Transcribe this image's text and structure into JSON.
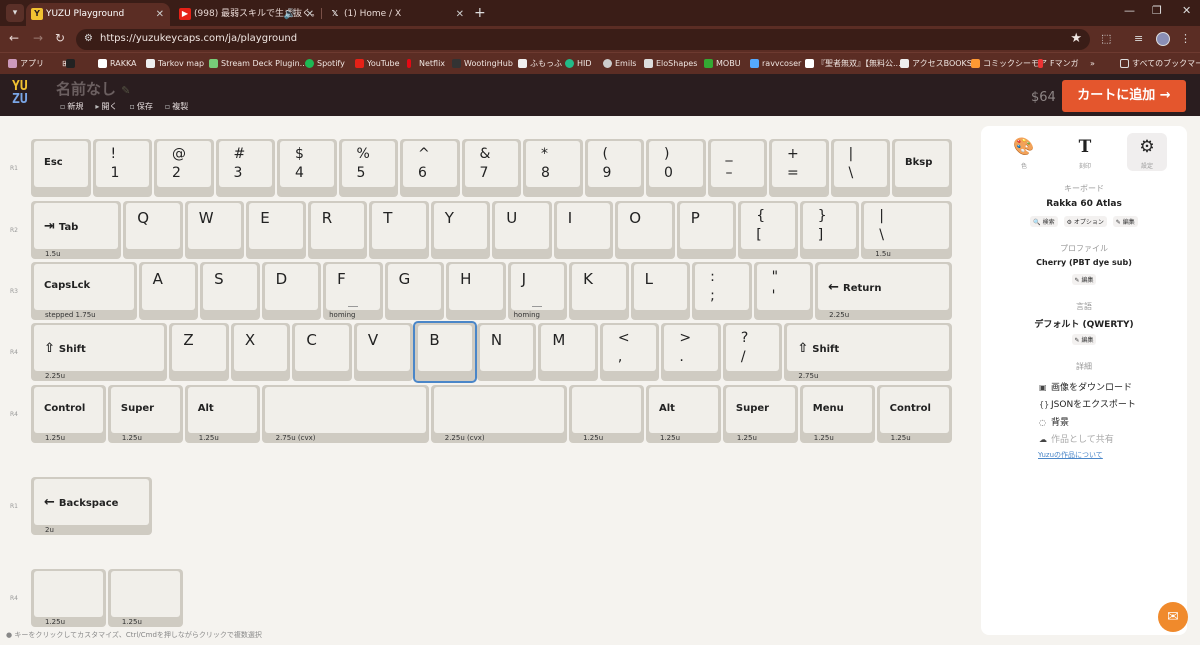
{
  "browser": {
    "tabs": [
      {
        "title": "YUZU Playground",
        "active": true,
        "icon": "yuzu-favicon"
      },
      {
        "title": "(998) 最弱スキルで生き抜く。",
        "active": false,
        "icon": "youtube-favicon"
      },
      {
        "title": "(1) Home / X",
        "active": false,
        "icon": "x-favicon"
      }
    ],
    "url": "https://yuzukeycaps.com/ja/playground",
    "bookmarks": [
      "アプリ",
      "RAKKA",
      "Tarkov map",
      "Stream Deck Plugin...",
      "Spotify",
      "YouTube",
      "Netflix",
      "WootingHub",
      "ふもっふ",
      "HID",
      "Emils",
      "EloShapes",
      "MOBU",
      "ravvcoser",
      "『聖者無双』【無料公...",
      "アクセスBOOKS",
      "コミックシーモア",
      "Fマンガ",
      "すべてのブックマーク"
    ],
    "overflow": "»"
  },
  "app": {
    "logo_top": "YU",
    "logo_bottom": "ZU",
    "doc_title": "名前なし",
    "doc_sub": "✎",
    "menu": [
      {
        "icon": "▫",
        "label": "新規"
      },
      {
        "icon": "▸",
        "label": "開く"
      },
      {
        "icon": "▫",
        "label": "保存"
      },
      {
        "icon": "▫",
        "label": "複製"
      }
    ],
    "price": "$64",
    "cart_label": "カートに追加 →"
  },
  "keyboard": {
    "row_labels": [
      "R1",
      "R2",
      "R3",
      "R4",
      "R4",
      "R1",
      "R4"
    ],
    "keys": [
      {
        "id": "esc",
        "leg": "Esc",
        "type": "mod"
      },
      {
        "id": "1",
        "leg": "!\n1",
        "type": "dual"
      },
      {
        "id": "2",
        "leg": "@\n2",
        "type": "dual"
      },
      {
        "id": "3",
        "leg": "#\n3",
        "type": "dual"
      },
      {
        "id": "4",
        "leg": "$\n4",
        "type": "dual"
      },
      {
        "id": "5",
        "leg": "%\n5",
        "type": "dual"
      },
      {
        "id": "6",
        "leg": "^\n6",
        "type": "dual"
      },
      {
        "id": "7",
        "leg": "&\n7",
        "type": "dual"
      },
      {
        "id": "8",
        "leg": "*\n8",
        "type": "dual"
      },
      {
        "id": "9",
        "leg": "(\n9",
        "type": "dual"
      },
      {
        "id": "0",
        "leg": ")\n0",
        "type": "dual"
      },
      {
        "id": "minus",
        "leg": "_\n–",
        "type": "dual"
      },
      {
        "id": "equal",
        "leg": "+\n=",
        "type": "dual"
      },
      {
        "id": "backslash-r1",
        "leg": "|\n\\",
        "type": "dual"
      },
      {
        "id": "bksp",
        "leg": "Bksp",
        "type": "mod"
      },
      {
        "id": "tab",
        "leg": "Tab",
        "type": "mod",
        "icon": "⇥",
        "size": "1.5u"
      },
      {
        "id": "q",
        "leg": "Q",
        "type": "big"
      },
      {
        "id": "w",
        "leg": "W",
        "type": "big"
      },
      {
        "id": "e",
        "leg": "E",
        "type": "big"
      },
      {
        "id": "r",
        "leg": "R",
        "type": "big"
      },
      {
        "id": "t",
        "leg": "T",
        "type": "big"
      },
      {
        "id": "y",
        "leg": "Y",
        "type": "big"
      },
      {
        "id": "u",
        "leg": "U",
        "type": "big"
      },
      {
        "id": "i",
        "leg": "I",
        "type": "big"
      },
      {
        "id": "o",
        "leg": "O",
        "type": "big"
      },
      {
        "id": "p",
        "leg": "P",
        "type": "big"
      },
      {
        "id": "lbracket",
        "leg": "{\n[",
        "type": "dual"
      },
      {
        "id": "rbracket",
        "leg": "}\n]",
        "type": "dual"
      },
      {
        "id": "pipe",
        "leg": "|\n\\",
        "type": "dual",
        "size": "1.5u"
      },
      {
        "id": "caps",
        "leg": "CapsLck",
        "type": "mod",
        "size": "stepped 1.75u"
      },
      {
        "id": "a",
        "leg": "A",
        "type": "big"
      },
      {
        "id": "s",
        "leg": "S",
        "type": "big"
      },
      {
        "id": "d",
        "leg": "D",
        "type": "big"
      },
      {
        "id": "f",
        "leg": "F",
        "type": "big",
        "homing": "homing"
      },
      {
        "id": "g",
        "leg": "G",
        "type": "big"
      },
      {
        "id": "h",
        "leg": "H",
        "type": "big"
      },
      {
        "id": "j",
        "leg": "J",
        "type": "big",
        "homing": "homing"
      },
      {
        "id": "k",
        "leg": "K",
        "type": "big"
      },
      {
        "id": "l",
        "leg": "L",
        "type": "big"
      },
      {
        "id": "semicolon",
        "leg": ":\n;",
        "type": "dual"
      },
      {
        "id": "quote",
        "leg": "\"\n'",
        "type": "dual"
      },
      {
        "id": "return",
        "leg": "Return",
        "type": "mod",
        "icon": "←",
        "size": "2.25u"
      },
      {
        "id": "lshift",
        "leg": "Shift",
        "type": "mod",
        "icon": "⇧",
        "size": "2.25u"
      },
      {
        "id": "z",
        "leg": "Z",
        "type": "big"
      },
      {
        "id": "x",
        "leg": "X",
        "type": "big"
      },
      {
        "id": "c",
        "leg": "C",
        "type": "big"
      },
      {
        "id": "v",
        "leg": "V",
        "type": "big"
      },
      {
        "id": "b",
        "leg": "B",
        "type": "big",
        "selected": true
      },
      {
        "id": "n",
        "leg": "N",
        "type": "big"
      },
      {
        "id": "m",
        "leg": "M",
        "type": "big"
      },
      {
        "id": "comma",
        "leg": "<\n,",
        "type": "dual"
      },
      {
        "id": "period",
        "leg": ">\n.",
        "type": "dual"
      },
      {
        "id": "slash",
        "leg": "?\n/",
        "type": "dual"
      },
      {
        "id": "rshift",
        "leg": "Shift",
        "type": "mod",
        "icon": "⇧",
        "size": "2.75u"
      },
      {
        "id": "lctrl",
        "leg": "Control",
        "type": "mod",
        "size": "1.25u"
      },
      {
        "id": "lsuper",
        "leg": "Super",
        "type": "mod",
        "size": "1.25u"
      },
      {
        "id": "lalt",
        "leg": "Alt",
        "type": "mod",
        "size": "1.25u"
      },
      {
        "id": "space1",
        "leg": "",
        "type": "mod",
        "size": "2.75u (cvx)"
      },
      {
        "id": "space2",
        "leg": "",
        "type": "mod",
        "size": "2.25u (cvx)"
      },
      {
        "id": "space3",
        "leg": "",
        "type": "mod",
        "size": "1.25u"
      },
      {
        "id": "ralt",
        "leg": "Alt",
        "type": "mod",
        "size": "1.25u"
      },
      {
        "id": "rsuper",
        "leg": "Super",
        "type": "mod",
        "size": "1.25u"
      },
      {
        "id": "menu",
        "leg": "Menu",
        "type": "mod",
        "size": "1.25u"
      },
      {
        "id": "rctrl",
        "leg": "Control",
        "type": "mod",
        "size": "1.25u"
      },
      {
        "id": "backspace-alt",
        "leg": "Backspace",
        "type": "mod",
        "icon": "←",
        "size": "2u"
      },
      {
        "id": "extra1",
        "leg": "",
        "type": "mod",
        "size": "1.25u"
      },
      {
        "id": "extra2",
        "leg": "",
        "type": "mod",
        "size": "1.25u"
      }
    ]
  },
  "hint": "キーをクリックしてカスタマイズ、Ctrl/Cmdを押しながらクリックで複数選択",
  "panel": {
    "tabs": [
      {
        "icon": "palette-icon",
        "glyph": "🎨",
        "label": "色"
      },
      {
        "icon": "text-icon",
        "glyph": "T",
        "label": "刻印"
      },
      {
        "icon": "gear-icon",
        "glyph": "⚙",
        "label": "設定"
      }
    ],
    "keyboard_h": "キーボード",
    "keyboard_v": "Rakka 60 Atlas",
    "keyboard_links": [
      "🔍 検索",
      "⚙ オプション",
      "✎ 編集"
    ],
    "profile_h": "プロファイル",
    "profile_v": "Cherry (PBT dye sub)",
    "profile_link": "✎ 編集",
    "lang_h": "言語",
    "lang_v": "デフォルト (QWERTY)",
    "lang_link": "✎ 編集",
    "detail_h": "詳細",
    "details": [
      {
        "icon": "image-icon",
        "glyph": "▣",
        "label": "画像をダウンロード",
        "disabled": false
      },
      {
        "icon": "json-icon",
        "glyph": "{}",
        "label": "JSONをエクスポート",
        "disabled": false
      },
      {
        "icon": "background-icon",
        "glyph": "◌",
        "label": "背景",
        "disabled": false
      },
      {
        "icon": "share-icon",
        "glyph": "☁",
        "label": "作品として共有",
        "disabled": true
      }
    ],
    "about": "Yuzuの作品について"
  }
}
